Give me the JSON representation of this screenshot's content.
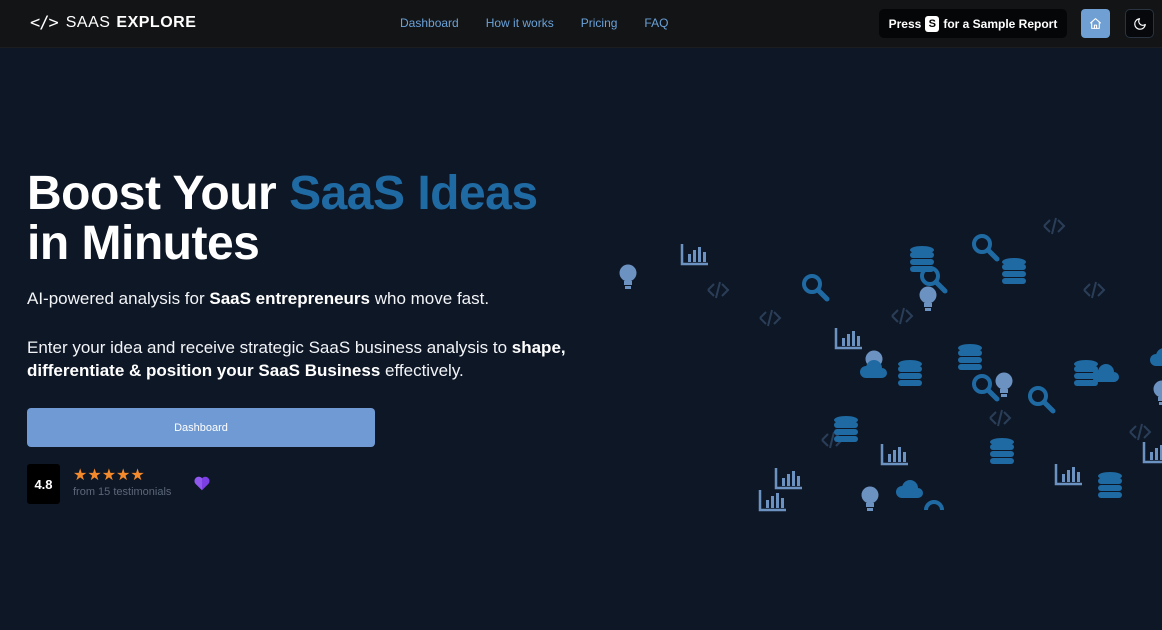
{
  "brand": {
    "icon": "</>",
    "word1": "SAAS",
    "word2": "EXPLORE"
  },
  "nav": [
    {
      "label": "Dashboard"
    },
    {
      "label": "How it works"
    },
    {
      "label": "Pricing"
    },
    {
      "label": "FAQ"
    }
  ],
  "sample_report": {
    "prefix": "Press",
    "key": "S",
    "suffix": "for a Sample Report"
  },
  "icons": {
    "home": "home-icon",
    "theme": "moon-icon"
  },
  "hero": {
    "title_plain": "Boost Your ",
    "title_accent": "SaaS Ideas",
    "title_line2": "in Minutes",
    "sub1_a": "AI-powered analysis for ",
    "sub1_b": "SaaS entrepreneurs",
    "sub1_c": " who move fast.",
    "sub2_a": "Enter your idea and receive strategic SaaS business analysis to ",
    "sub2_b": "shape, differentiate & position your SaaS Business",
    "sub2_c": " effectively."
  },
  "cta": {
    "label": "Dashboard"
  },
  "rating": {
    "score": "4.8",
    "stars": "★★★★★",
    "subtext": "from 15 testimonials"
  },
  "colors": {
    "background": "#0e1726",
    "topbar": "#131416",
    "accent": "#1f6aa3",
    "nav_link": "#6aa2d8",
    "button": "#6f9ad3",
    "star": "#f48a2b",
    "heart": "#7b3fe4"
  }
}
